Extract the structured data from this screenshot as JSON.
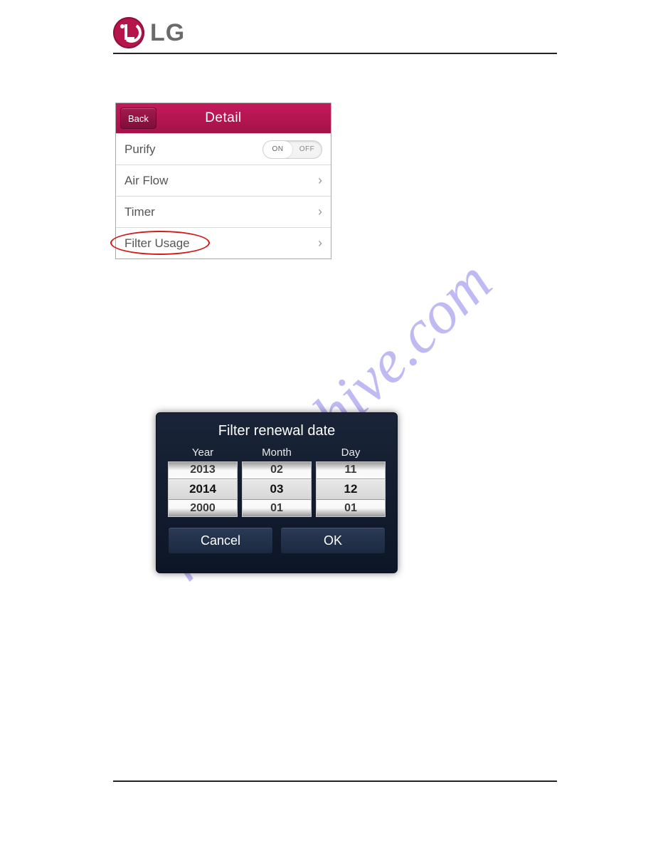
{
  "brand": {
    "name": "LG"
  },
  "watermark": "manualshive.com",
  "detail_panel": {
    "back_label": "Back",
    "title": "Detail",
    "rows": {
      "purify": {
        "label": "Purify",
        "toggle": {
          "on": "ON",
          "off": "OFF",
          "state": "ON"
        }
      },
      "airflow": {
        "label": "Air Flow"
      },
      "timer": {
        "label": "Timer"
      },
      "filter_usage": {
        "label": "Filter Usage"
      }
    }
  },
  "date_dialog": {
    "title": "Filter renewal date",
    "columns": {
      "year": {
        "header": "Year",
        "prev": "2013",
        "selected": "2014",
        "next": "2000"
      },
      "month": {
        "header": "Month",
        "prev": "02",
        "selected": "03",
        "next": "01"
      },
      "day": {
        "header": "Day",
        "prev": "11",
        "selected": "12",
        "next": "01"
      }
    },
    "buttons": {
      "cancel": "Cancel",
      "ok": "OK"
    }
  }
}
